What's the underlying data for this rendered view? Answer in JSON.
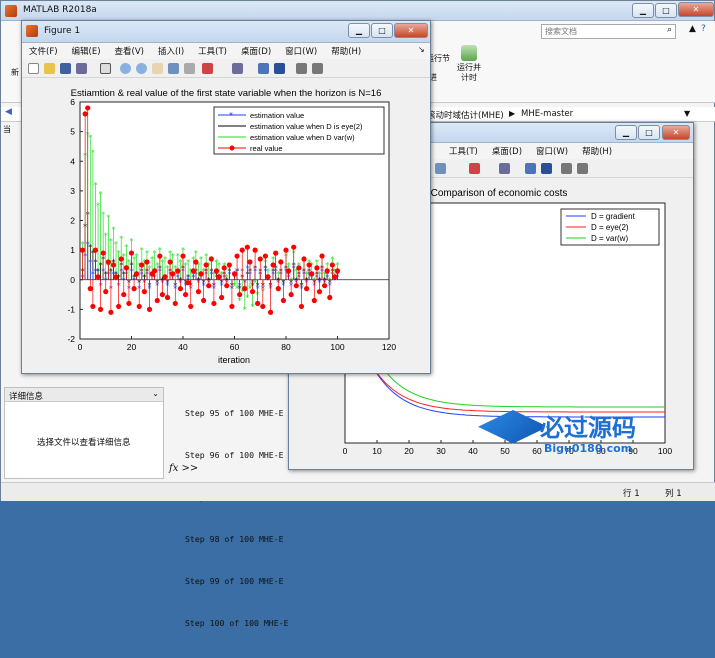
{
  "matlab": {
    "title": "MATLAB R2018a",
    "search_placeholder": "搜索文档",
    "btn_new": "新",
    "btn_run_section": "运行节",
    "btn_advance": "进",
    "btn_run_time": "运行并\n计时",
    "details_title": "详细信息",
    "details_hint": "选择文件以查看详细信息",
    "fx": "fx >>",
    "status_row": "行 1",
    "status_col": "列 1",
    "side_letter": "当",
    "path_items": [
      "滚动时域估计(MHE)",
      "MHE-master"
    ],
    "console_lines": [
      "Step 95 of 100 MHE-E",
      "Step 96 of 100 MHE-E",
      "Step 97 of 100 MHE-E",
      "Step 98 of 100 MHE-E",
      "Step 99 of 100 MHE-E",
      "Step 100 of 100 MHE-E"
    ]
  },
  "figure1": {
    "title": "Figure 1",
    "menu": [
      "文件(F)",
      "编辑(E)",
      "查看(V)",
      "插入(I)",
      "工具(T)",
      "桌面(D)",
      "窗口(W)",
      "帮助(H)"
    ],
    "chart_data": {
      "type": "line",
      "title": "Estiamtion & real value of the first state variable when the horizon is N=16",
      "xlabel": "iteration",
      "ylabel": "",
      "xlim": [
        0,
        120
      ],
      "ylim": [
        -2,
        6
      ],
      "xticks": [
        0,
        20,
        40,
        60,
        80,
        100,
        120
      ],
      "yticks": [
        -2,
        -1,
        0,
        1,
        2,
        3,
        4,
        5,
        6
      ],
      "legend_position": "top-right",
      "series": [
        {
          "name": "estimation value",
          "color": "#1f3fff",
          "marker": "*"
        },
        {
          "name": "estimation value when D is eye(2)",
          "color": "#000000",
          "marker": "*"
        },
        {
          "name": "estimation value when D var(w)",
          "color": "#22dd22",
          "marker": "*"
        },
        {
          "name": "real value",
          "color": "#ff0000",
          "marker": "o"
        }
      ],
      "x": [
        1,
        2,
        3,
        4,
        5,
        6,
        7,
        8,
        9,
        10,
        11,
        12,
        13,
        14,
        15,
        16,
        17,
        18,
        19,
        20,
        21,
        22,
        23,
        24,
        25,
        26,
        27,
        28,
        29,
        30,
        31,
        32,
        33,
        34,
        35,
        36,
        37,
        38,
        39,
        40,
        41,
        42,
        43,
        44,
        45,
        46,
        47,
        48,
        49,
        50,
        51,
        52,
        53,
        54,
        55,
        56,
        57,
        58,
        59,
        60,
        61,
        62,
        63,
        64,
        65,
        66,
        67,
        68,
        69,
        70,
        71,
        72,
        73,
        74,
        75,
        76,
        77,
        78,
        79,
        80,
        81,
        82,
        83,
        84,
        85,
        86,
        87,
        88,
        89,
        90,
        91,
        92,
        93,
        94,
        95,
        96,
        97,
        98,
        99,
        100
      ],
      "real": [
        1.0,
        5.6,
        5.8,
        -0.3,
        -0.9,
        1.0,
        0.1,
        -1.0,
        0.9,
        -0.4,
        0.6,
        -1.1,
        0.5,
        0.1,
        -0.9,
        0.7,
        -0.5,
        0.4,
        -0.8,
        0.9,
        -0.3,
        0.2,
        -0.9,
        0.5,
        -0.4,
        0.6,
        -1.0,
        0.2,
        0.3,
        -0.7,
        0.8,
        -0.5,
        0.1,
        -0.6,
        0.6,
        0.2,
        -0.8,
        0.3,
        -0.3,
        0.8,
        -0.5,
        -0.1,
        -0.9,
        0.3,
        0.6,
        -0.4,
        0.2,
        -0.7,
        0.5,
        -0.2,
        0.7,
        -0.8,
        0.3,
        0.1,
        -0.6,
        0.4,
        -0.2,
        0.5,
        -0.9,
        0.2,
        0.8,
        -0.5,
        1.0,
        -0.3,
        1.1,
        0.6,
        -0.4,
        1.0,
        -0.8,
        0.7,
        -0.9,
        0.8,
        0.1,
        -1.1,
        0.5,
        0.9,
        -0.3,
        0.6,
        -0.7,
        1.0,
        0.3,
        -0.5,
        1.1,
        -0.2,
        0.4,
        -0.9,
        0.7,
        -0.3,
        0.5,
        0.2,
        -0.7,
        0.4,
        -0.4,
        0.8,
        -0.2,
        0.3,
        -0.6,
        0.5,
        0.1,
        0.3
      ],
      "est": [
        0.1,
        0.8,
        1.2,
        0.6,
        0.2,
        0.3,
        0.1,
        -0.2,
        0.3,
        0.0,
        0.2,
        -0.3,
        0.2,
        0.1,
        -0.2,
        0.3,
        0.0,
        0.2,
        -0.3,
        0.3,
        0.0,
        0.1,
        -0.3,
        0.2,
        -0.1,
        0.2,
        -0.3,
        0.1,
        0.1,
        -0.2,
        0.3,
        -0.1,
        0.0,
        -0.2,
        0.2,
        0.1,
        -0.3,
        0.1,
        -0.1,
        0.3,
        -0.2,
        0.0,
        -0.3,
        0.1,
        0.2,
        -0.1,
        0.1,
        -0.2,
        0.2,
        -0.1,
        0.2,
        -0.3,
        0.1,
        0.0,
        -0.2,
        0.1,
        -0.1,
        0.2,
        -0.3,
        0.1,
        0.3,
        -0.2,
        0.3,
        -0.1,
        0.4,
        0.2,
        -0.1,
        0.3,
        -0.3,
        0.2,
        -0.3,
        0.3,
        0.0,
        -0.3,
        0.2,
        0.3,
        -0.1,
        0.2,
        -0.2,
        0.3,
        0.1,
        -0.2,
        0.4,
        -0.1,
        0.1,
        -0.3,
        0.2,
        -0.1,
        0.2,
        0.1,
        -0.2,
        0.1,
        -0.1,
        0.3,
        -0.1,
        0.1,
        -0.2,
        0.2,
        0.0,
        0.1
      ],
      "est_eye": [
        0.3,
        1.8,
        2.2,
        1.1,
        0.9,
        0.6,
        0.3,
        0.5,
        0.7,
        0.2,
        0.5,
        0.3,
        0.6,
        0.2,
        0.1,
        0.5,
        0.2,
        0.4,
        -0.1,
        0.5,
        0.1,
        0.2,
        -0.1,
        0.3,
        0.1,
        0.3,
        -0.2,
        0.2,
        0.3,
        -0.1,
        0.4,
        0.0,
        0.1,
        -0.1,
        0.3,
        0.2,
        -0.2,
        0.2,
        0.0,
        0.4,
        -0.1,
        0.1,
        -0.2,
        0.2,
        0.3,
        0.0,
        0.2,
        -0.1,
        0.3,
        0.0,
        0.3,
        -0.2,
        0.2,
        0.1,
        -0.1,
        0.2,
        0.0,
        0.3,
        -0.2,
        0.2,
        0.3,
        -0.3,
        0.1,
        -0.3,
        0.2,
        0.3,
        -0.2,
        0.4,
        -0.2,
        0.3,
        -0.2,
        0.4,
        0.1,
        -0.2,
        0.3,
        0.4,
        0.0,
        0.3,
        -0.1,
        0.4,
        0.2,
        -0.1,
        0.5,
        0.0,
        0.2,
        -0.2,
        0.3,
        0.0,
        0.3,
        0.2,
        -0.1,
        0.2,
        0.0,
        0.4,
        0.0,
        0.2,
        -0.1,
        0.3,
        0.1,
        0.2
      ],
      "est_var": [
        1.2,
        4.2,
        4.9,
        4.8,
        4.3,
        3.2,
        2.5,
        2.9,
        2.2,
        1.5,
        2.1,
        1.3,
        1.7,
        1.2,
        0.9,
        1.4,
        0.8,
        1.1,
        0.6,
        1.3,
        0.7,
        0.8,
        0.5,
        1.0,
        0.6,
        0.9,
        0.4,
        0.7,
        0.9,
        0.5,
        1.0,
        0.6,
        0.7,
        0.4,
        0.9,
        0.8,
        0.4,
        0.8,
        0.6,
        1.0,
        0.5,
        0.6,
        0.3,
        0.7,
        0.9,
        0.5,
        0.7,
        0.3,
        0.8,
        0.5,
        0.7,
        0.2,
        0.6,
        0.5,
        0.2,
        0.5,
        0.1,
        0.4,
        -0.3,
        -0.2,
        -0.3,
        -0.7,
        -0.4,
        -1.0,
        -0.6,
        -0.3,
        -0.9,
        -0.1,
        -0.5,
        0.2,
        -0.4,
        0.6,
        0.3,
        -0.2,
        0.7,
        0.8,
        0.2,
        0.6,
        -0.1,
        0.8,
        0.5,
        0.0,
        0.9,
        0.3,
        0.5,
        -0.2,
        0.7,
        0.2,
        0.6,
        0.5,
        0.0,
        0.6,
        0.2,
        0.8,
        0.2,
        0.5,
        0.0,
        0.7,
        0.3,
        0.5
      ]
    }
  },
  "figure2": {
    "menu": [
      "工具(T)",
      "桌面(D)",
      "窗口(W)",
      "帮助(H)"
    ],
    "chart_data": {
      "type": "line",
      "title": "Comparison of economic costs",
      "xlabel": "",
      "ylabel": "",
      "xlim": [
        0,
        100
      ],
      "xticks": [
        0,
        10,
        20,
        30,
        40,
        50,
        60,
        70,
        80,
        90,
        100
      ],
      "legend_position": "top-right",
      "series": [
        {
          "name": "D = gradient",
          "color": "#1f3fff"
        },
        {
          "name": "D = eye(2)",
          "color": "#ff2020"
        },
        {
          "name": "D = var(w)",
          "color": "#22cc22"
        }
      ]
    }
  },
  "watermark": {
    "text": "必过源码",
    "url": "Bigu0180.com"
  }
}
